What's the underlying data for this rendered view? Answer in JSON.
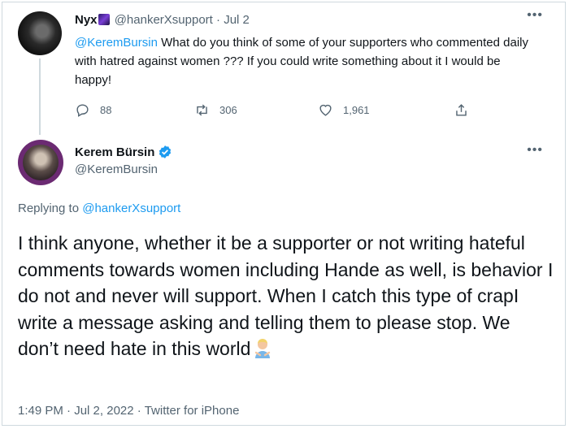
{
  "parent_tweet": {
    "display_name": "Nyx",
    "handle": "@hankerXsupport",
    "separator": "·",
    "date": "Jul 2",
    "mention": "@KeremBursin",
    "text": " What do you think of some of your supporters who commented daily with hatred against women ??? If you could write something about it I would be happy!",
    "reply_count": "88",
    "retweet_count": "306",
    "like_count": "1,961"
  },
  "main_tweet": {
    "display_name": "Kerem Bürsin",
    "handle": "@KeremBursin",
    "replying_prefix": "Replying to ",
    "replying_to": "@hankerXsupport",
    "text": "I think anyone, whether it be a supporter or not writing hateful comments towards women including Hande as well, is behavior I do not and never will support. When I catch this type of crapI write a message asking and telling them to please stop. We don’t need hate in this world",
    "time": "1:49 PM",
    "separator": "·",
    "date": "Jul 2, 2022",
    "source": "Twitter for iPhone"
  },
  "icons": {
    "more": "more-icon",
    "reply": "reply-icon",
    "retweet": "retweet-icon",
    "like": "heart-icon",
    "share": "share-icon",
    "verified": "verified-badge-icon",
    "emoji_face": "person-gesturing-emoji"
  },
  "colors": {
    "link": "#1d9bf0",
    "secondary_text": "#536471",
    "primary_text": "#0f1419",
    "border": "#cfd9de"
  }
}
